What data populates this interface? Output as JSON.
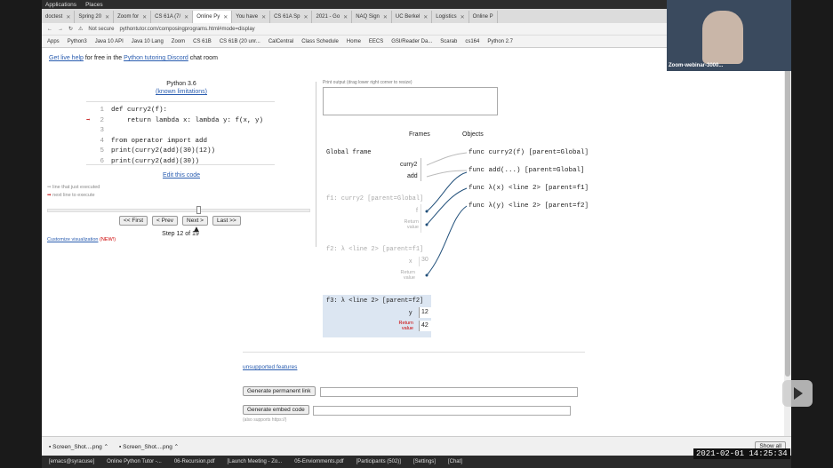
{
  "os": {
    "menu": [
      "Applications",
      "Places"
    ]
  },
  "tabs": [
    "doctest",
    "Spring 20",
    "Zoom for",
    "CS 61A (7/",
    "Online Py",
    "You have",
    "CS 61A Sp",
    "2021 - Go",
    "NAQ Sign",
    "UC Berkel",
    "Logistics",
    "Online P"
  ],
  "address": {
    "security": "Not secure",
    "url": "pythontutor.com/composingprograms.html#mode=display"
  },
  "bookmarks": [
    "Apps",
    "Python3",
    "Java 10 API",
    "Java 10 Lang",
    "Zoom",
    "CS 61B",
    "CS 61B (20 unr...",
    "CalCentral",
    "Class Schedule",
    "Home",
    "EECS",
    "GSI/Reader Da...",
    "Scarab",
    "cs164",
    "Python 2.7"
  ],
  "help": {
    "link1": "Get live help",
    "mid": " for free in the ",
    "link2": "Python tutoring Discord",
    "end": " chat room"
  },
  "editor": {
    "lang": "Python 3.6",
    "limits": "(known limitations)",
    "lines": [
      {
        "n": "1",
        "t": "def curry2(f):"
      },
      {
        "n": "2",
        "t": "    return lambda x: lambda y: f(x, y)"
      },
      {
        "n": "3",
        "t": ""
      },
      {
        "n": "4",
        "t": "from operator import add"
      },
      {
        "n": "5",
        "t": "print(curry2(add)(30)(12))"
      },
      {
        "n": "6",
        "t": "print(curry2(add)(30))"
      }
    ],
    "edit": "Edit this code",
    "legend1": "line that just executed",
    "legend2": "next line to execute",
    "first": "<< First",
    "prev": "< Prev",
    "next": "Next >",
    "last": "Last >>",
    "step": "Step 12 of 19",
    "customize": "Customize visualization",
    "new": "(NEW!)"
  },
  "output": {
    "label": "Print output (drag lower right corner to resize)"
  },
  "viz": {
    "frames": "Frames",
    "objects": "Objects",
    "global": "Global frame",
    "g_curry2": "curry2",
    "g_add": "add",
    "f1": "f1: curry2 [parent=Global]",
    "f1_f": "f",
    "f1_ret": "Return value",
    "f2": "f2: λ <line 2> [parent=f1]",
    "f2_x": "x",
    "f2_xv": "30",
    "f2_ret": "Return value",
    "f3": "f3: λ <line 2> [parent=f2]",
    "f3_y": "y",
    "f3_yv": "12",
    "f3_ret": "Return value",
    "f3_rv": "42",
    "o1": "func curry2(f) [parent=Global]",
    "o2": "func add(...) [parent=Global]",
    "o3": "func λ(x) <line 2> [parent=f1]",
    "o4": "func λ(y) <line 2> [parent=f2]"
  },
  "bottom": {
    "unsupported": "unsupported features",
    "perm": "Generate permanent link",
    "embed": "Generate embed code",
    "also": "(also supports https://)"
  },
  "downloads": [
    "Screen_Shot....png",
    "Screen_Shot....png"
  ],
  "showall": "Show all",
  "taskbar": [
    "[emacs@syracuse]",
    "Online Python Tutor -...",
    "06-Recursion.pdf",
    "[Launch Meeting - Zo...",
    "05-Enviornments.pdf",
    "[Participants (502)]",
    "[Settings]",
    "[Chat]"
  ],
  "video_label": "Zoom-webinar-3000...",
  "timestamp": "2021-02-01 14:25:34"
}
